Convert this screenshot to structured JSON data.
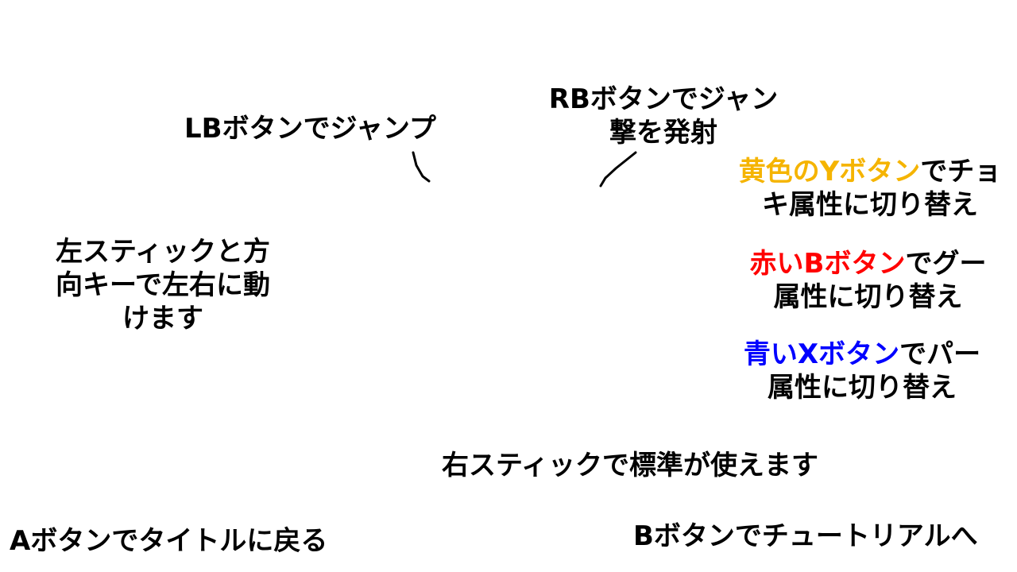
{
  "lb": {
    "text": "LBボタンでジャンプ"
  },
  "rb": {
    "line1": "RBボタンでジャン",
    "line2": "撃を発射"
  },
  "y": {
    "colored": "黄色のYボタン",
    "rest1": "でチョ",
    "line2": "キ属性に切り替え"
  },
  "b_red": {
    "colored": "赤いBボタン",
    "rest1": "でグー",
    "line2": "属性に切り替え"
  },
  "x": {
    "colored": "青いXボタン",
    "rest1": "でパー",
    "line2": "属性に切り替え"
  },
  "left_stick": {
    "line1": "左スティックと方",
    "line2": "向キーで左右に動",
    "line3": "けます"
  },
  "right_stick": {
    "text": "右スティックで標準が使えます"
  },
  "a_button": {
    "text": "Aボタンでタイトルに戻る"
  },
  "b_button": {
    "text": "Bボタンでチュートリアルへ"
  },
  "colors": {
    "yellow": "#f5b400",
    "red": "#ff0000",
    "blue": "#0000ff"
  }
}
